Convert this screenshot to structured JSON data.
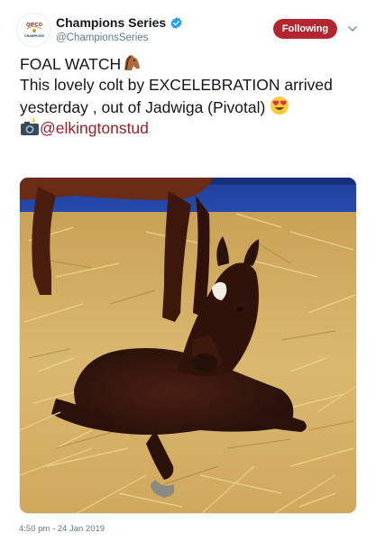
{
  "account": {
    "display_name": "Champions Series",
    "handle": "@ChampionsSeries",
    "avatar_icon": "qipco-champions-logo",
    "avatar_text_top": "QIPCO",
    "avatar_text_bottom": "CHAMPIONS",
    "verified_icon": "verified-badge-icon",
    "brand_color": "#b3262f"
  },
  "follow_button": {
    "label": "Following"
  },
  "menu": {
    "icon": "chevron-down-icon"
  },
  "tweet": {
    "line1": "FOAL WATCH",
    "line1_emoji": "horse-face-emoji",
    "line2": "This lovely colt by EXCELEBRATION arrived",
    "line3": "yesterday , out of Jadwiga (Pivotal)",
    "line3_emoji": "heart-eyes-emoji",
    "photo_credit_emoji": "camera-with-flash-emoji",
    "mention": "@elkingtonstud",
    "mention_color": "#9b1f27"
  },
  "media": {
    "subject": "newborn dark bay foal with white star lying in straw beside mare's legs"
  },
  "meta": {
    "timestamp": "4:50 pm - 24 Jan 2019"
  }
}
